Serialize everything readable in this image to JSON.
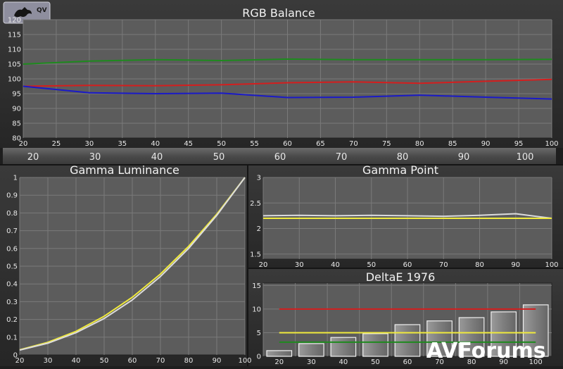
{
  "logo_label": "QV",
  "watermark": "AVForums",
  "band_labels": [
    "20",
    "30",
    "40",
    "50",
    "60",
    "70",
    "80",
    "90",
    "100"
  ],
  "colors": {
    "red": "#d41e1e",
    "green": "#1e8a1e",
    "blue": "#1a1ac8",
    "yellow": "#f0ea3c",
    "white": "#dcdcdc",
    "plot_bg": "#5c5c5c",
    "panel_bg": "#2a2a2a"
  },
  "chart_data": [
    {
      "id": "rgb",
      "type": "line",
      "title": "RGB Balance",
      "xlabel": "",
      "ylabel": "",
      "x_ticks": [
        20,
        25,
        30,
        35,
        40,
        45,
        50,
        55,
        60,
        65,
        70,
        75,
        80,
        85,
        90,
        95,
        100
      ],
      "y_ticks": [
        80,
        85,
        90,
        95,
        100,
        105,
        110,
        115,
        120
      ],
      "xlim": [
        20,
        100
      ],
      "ylim": [
        80,
        120
      ],
      "grid": true,
      "series": [
        {
          "color": "green",
          "x": [
            20,
            30,
            40,
            50,
            60,
            70,
            80,
            90,
            100
          ],
          "y": [
            105,
            106,
            106.5,
            106.2,
            106.7,
            106.5,
            106.5,
            106.5,
            106.6
          ]
        },
        {
          "color": "red",
          "x": [
            20,
            30,
            40,
            50,
            60,
            70,
            80,
            90,
            100
          ],
          "y": [
            97.5,
            97.8,
            97.7,
            98,
            98.7,
            99,
            98.5,
            99.2,
            99.8
          ]
        },
        {
          "color": "blue",
          "x": [
            20,
            30,
            40,
            50,
            60,
            70,
            80,
            90,
            100
          ],
          "y": [
            97.5,
            95.3,
            95,
            95.2,
            93.7,
            93.8,
            94.5,
            93.8,
            93.2
          ]
        }
      ]
    },
    {
      "id": "gamma_lum",
      "type": "line",
      "title": "Gamma Luminance",
      "xlabel": "",
      "ylabel": "",
      "x_ticks": [
        20,
        30,
        40,
        50,
        60,
        70,
        80,
        90,
        100
      ],
      "y_ticks": [
        0,
        0.1,
        0.2,
        0.3,
        0.4,
        0.5,
        0.6,
        0.7,
        0.8,
        0.9,
        1
      ],
      "xlim": [
        20,
        100
      ],
      "ylim": [
        0,
        1
      ],
      "grid": true,
      "series": [
        {
          "color": "yellow",
          "x": [
            20,
            30,
            40,
            50,
            60,
            70,
            80,
            90,
            100
          ],
          "y": [
            0.029,
            0.071,
            0.133,
            0.218,
            0.325,
            0.456,
            0.612,
            0.793,
            1
          ]
        },
        {
          "color": "white",
          "x": [
            20,
            30,
            40,
            50,
            60,
            70,
            80,
            90,
            100
          ],
          "y": [
            0.027,
            0.066,
            0.125,
            0.205,
            0.31,
            0.442,
            0.6,
            0.786,
            1
          ]
        }
      ]
    },
    {
      "id": "gamma_point",
      "type": "line",
      "title": "Gamma Point",
      "xlabel": "",
      "ylabel": "",
      "x_ticks": [
        20,
        30,
        40,
        50,
        60,
        70,
        80,
        90,
        100
      ],
      "y_ticks": [
        1.5,
        2,
        2.5,
        3
      ],
      "xlim": [
        20,
        100
      ],
      "ylim": [
        1.4,
        3
      ],
      "grid": true,
      "series": [
        {
          "color": "white",
          "x": [
            20,
            30,
            40,
            50,
            60,
            70,
            80,
            90,
            100
          ],
          "y": [
            2.25,
            2.26,
            2.25,
            2.26,
            2.25,
            2.24,
            2.26,
            2.29,
            2.2
          ]
        },
        {
          "color": "yellow",
          "x": [
            20,
            100
          ],
          "y": [
            2.2,
            2.2
          ]
        }
      ]
    },
    {
      "id": "deltae",
      "type": "bar",
      "title": "DeltaE 1976",
      "xlabel": "",
      "ylabel": "",
      "categories": [
        20,
        30,
        40,
        50,
        60,
        70,
        80,
        90,
        100
      ],
      "values": [
        1.2,
        2.7,
        4,
        4.8,
        6.7,
        7.5,
        8.2,
        9.4,
        10.9
      ],
      "y_ticks": [
        0,
        5,
        10,
        15
      ],
      "ylim": [
        0,
        15.5
      ],
      "grid": true,
      "thresholds": [
        {
          "color": "red",
          "value": 10
        },
        {
          "color": "yellow",
          "value": 5
        },
        {
          "color": "green",
          "value": 3
        }
      ]
    }
  ]
}
